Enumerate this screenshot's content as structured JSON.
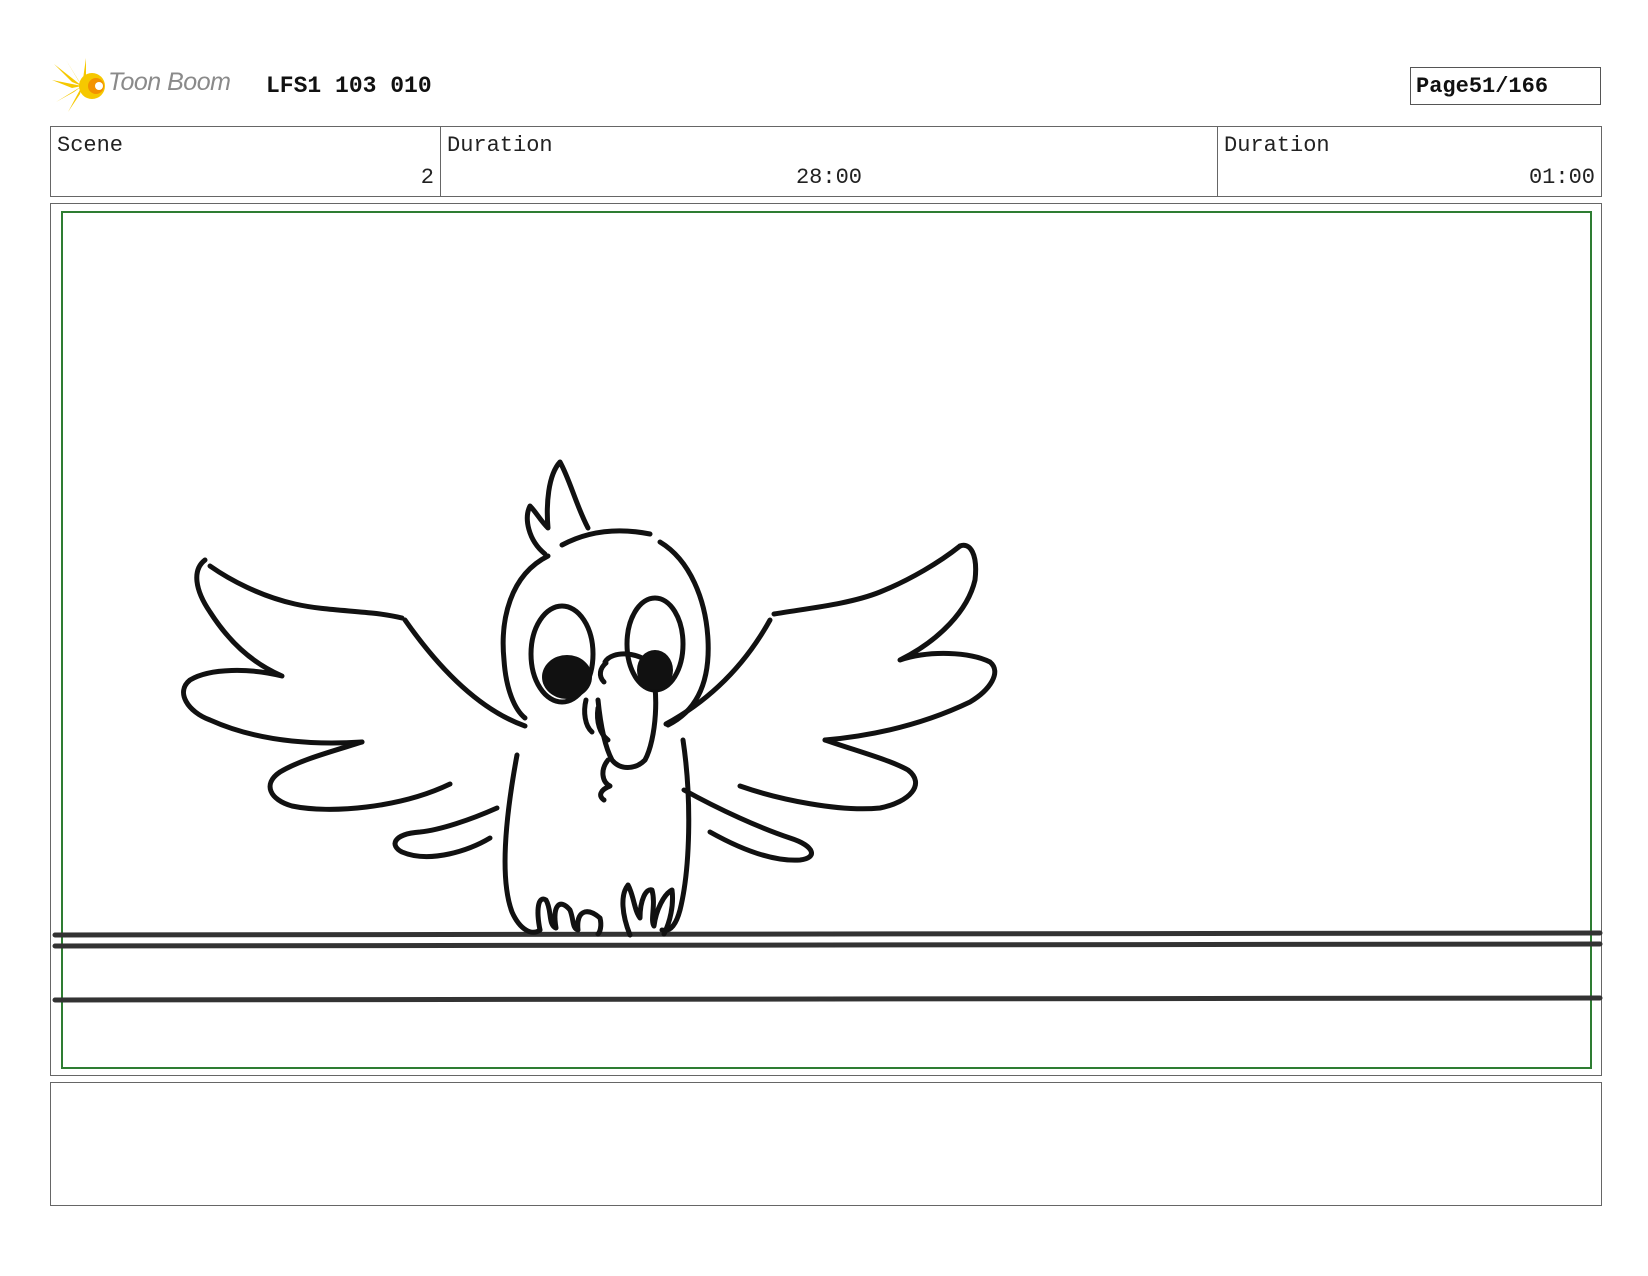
{
  "header": {
    "logo_text": "Toon Boom",
    "project_id": "LFS1 103 010",
    "page_label": "Page",
    "page_value": "51/166"
  },
  "info": {
    "scene_label": "Scene",
    "scene_value": "2",
    "duration_label": "Duration",
    "duration_value": "28:00",
    "panel_duration_label": "Duration",
    "panel_duration_value": "01:00"
  },
  "notes": {
    "text": ""
  },
  "colors": {
    "safe_frame": "#2e7d32",
    "logo_yellow": "#f6c800",
    "logo_orange": "#f39200"
  },
  "icons": {
    "logo": "toon-boom-starburst-icon"
  }
}
